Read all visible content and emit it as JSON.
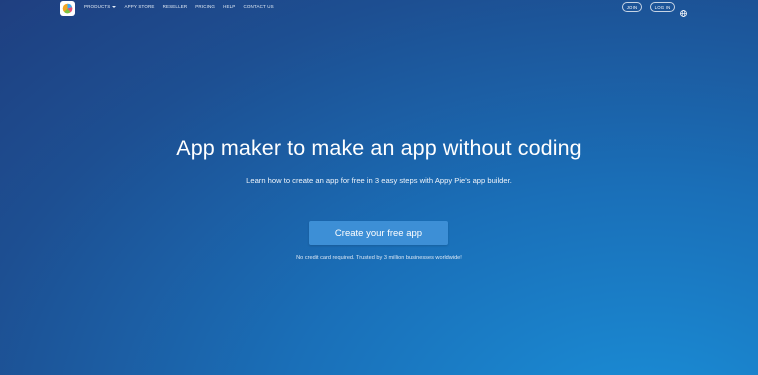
{
  "nav": {
    "items": [
      {
        "label": "PRODUCTS",
        "has_dropdown": true
      },
      {
        "label": "APPY STORE"
      },
      {
        "label": "RESELLER"
      },
      {
        "label": "PRICING"
      },
      {
        "label": "HELP"
      },
      {
        "label": "CONTACT US"
      }
    ],
    "join_label": "JOIN",
    "login_label": "LOG IN",
    "logo_icon": "appy-pie-logo-icon",
    "language_icon": "globe-icon"
  },
  "hero": {
    "title": "App maker to make an app without coding",
    "subtitle": "Learn how to create an app for free in 3 easy steps with Appy Pie's app builder.",
    "cta_label": "Create your free app",
    "note": "No credit card required. Trusted by 3 million businesses worldwide!"
  },
  "colors": {
    "background_top": "#1f3f80",
    "background_bottom": "#1a8fd8",
    "cta": "#3d8fd6"
  }
}
